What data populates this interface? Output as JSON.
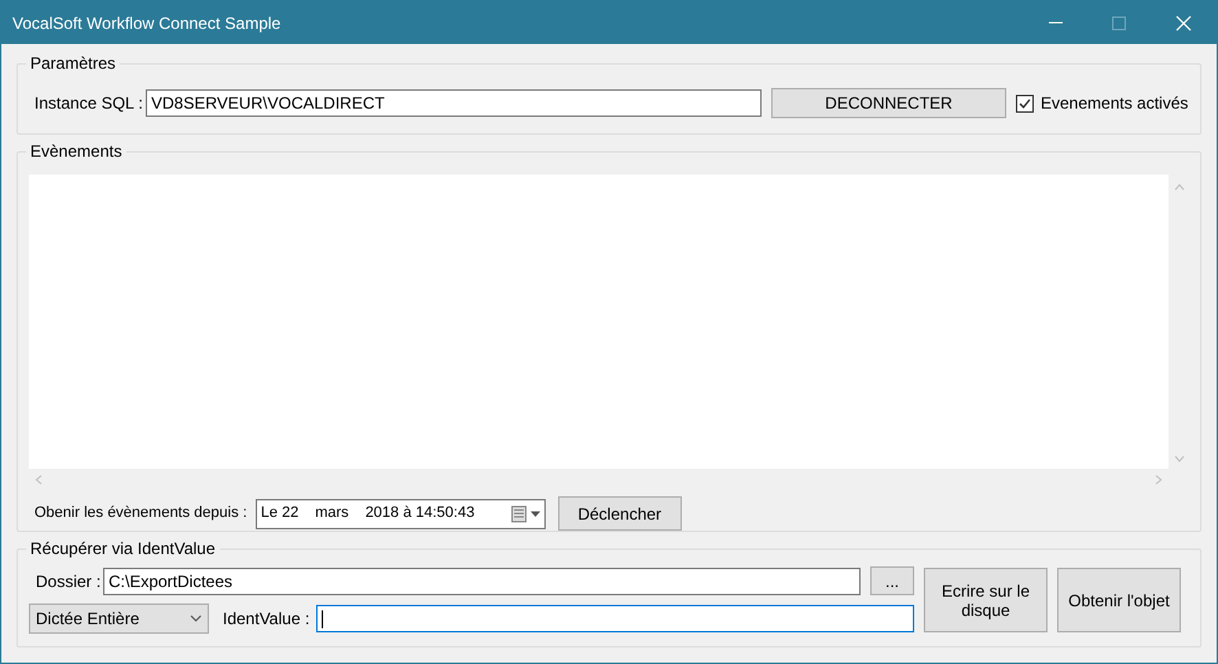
{
  "window": {
    "title": "VocalSoft Workflow Connect Sample"
  },
  "parametres": {
    "title": "Paramètres",
    "sql_label": "Instance SQL :",
    "sql_value": "VD8SERVEUR\\VOCALDIRECT",
    "connect_button": "DECONNECTER",
    "events_checkbox": {
      "label": "Evenements activés",
      "checked": true
    }
  },
  "evenements": {
    "title": "Evènements",
    "since_label": "Obenir les évènements depuis :",
    "date_parts": [
      "Le 22",
      "mars",
      "2018 à 14:50:43"
    ],
    "trigger_button": "Déclencher"
  },
  "recuperer": {
    "title": "Récupérer via IdentValue",
    "folder_label": "Dossier :",
    "folder_value": "C:\\ExportDictees",
    "browse_button": "...",
    "mode_select": "Dictée Entière",
    "ident_label": "IdentValue :",
    "ident_field": {
      "focused": true
    },
    "write_button": "Ecrire sur le disque",
    "get_button": "Obtenir l'objet"
  }
}
